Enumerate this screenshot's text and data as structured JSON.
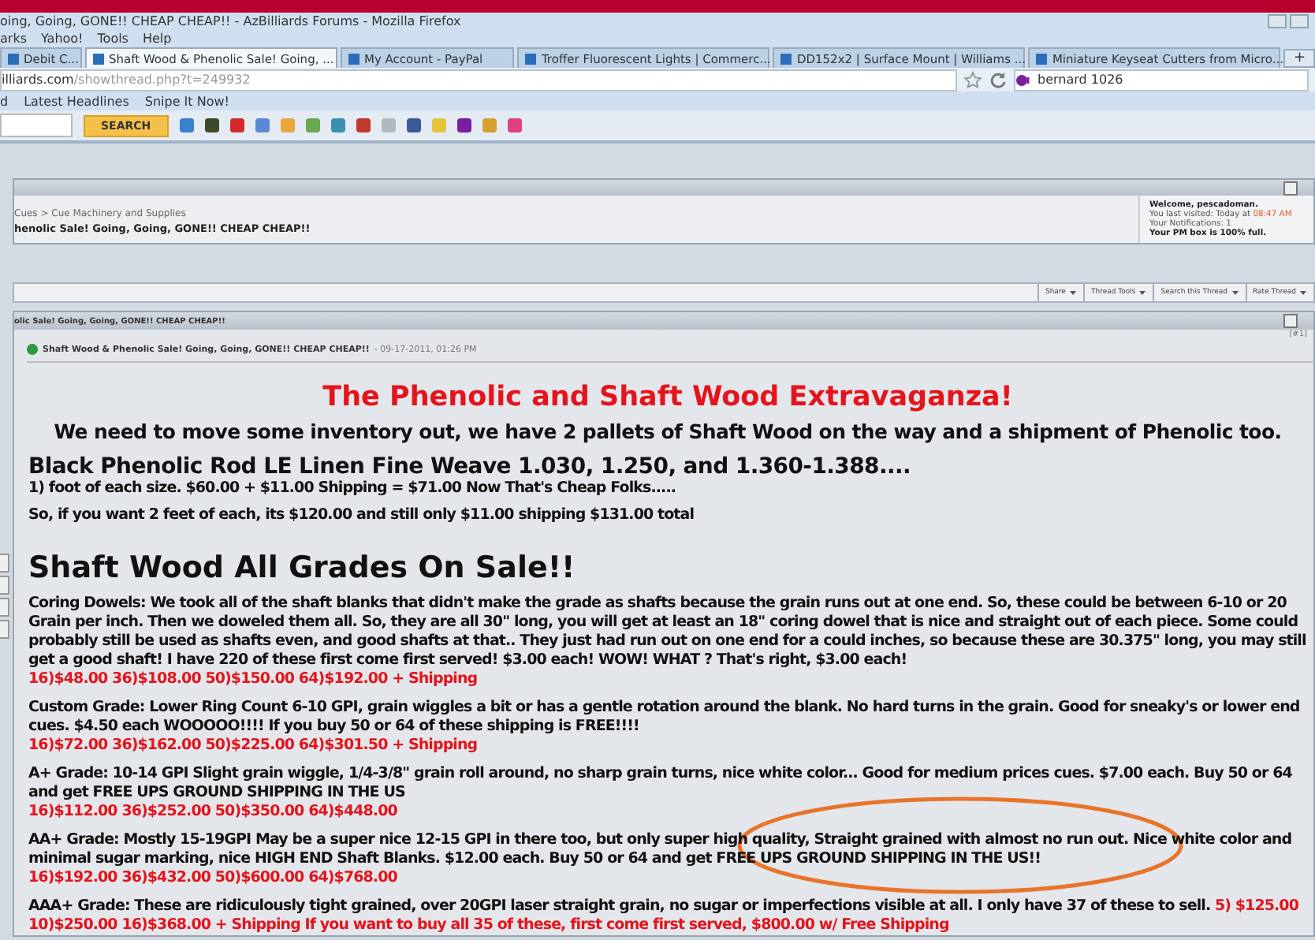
{
  "window": {
    "title": "oing, Going, GONE!! CHEAP CHEAP!! - AzBilliards Forums - Mozilla Firefox"
  },
  "menu": [
    "arks",
    "Yahoo!",
    "Tools",
    "Help"
  ],
  "tabs": [
    {
      "label": "Debit C...",
      "selected": false
    },
    {
      "label": "Shaft Wood & Phenolic Sale! Going, ...",
      "selected": true
    },
    {
      "label": "My Account - PayPal",
      "selected": false
    },
    {
      "label": "Troffer Fluorescent Lights | Commerc...",
      "selected": false
    },
    {
      "label": "DD152x2 | Surface Mount | Williams ...",
      "selected": false
    },
    {
      "label": "Miniature Keyseat Cutters from Micro...",
      "selected": false
    }
  ],
  "address_bar": {
    "url_host": "illiards.com",
    "url_path": "/showthread.php?t=249932",
    "search_value": "bernard 1026"
  },
  "new_tab": "+",
  "bookmarks": [
    "d",
    "Latest Headlines",
    "Snipe It Now!"
  ],
  "toolbar": {
    "search_button": "SEARCH"
  },
  "breadcrumb": {
    "path": "Cues > Cue Machinery and Supplies",
    "title": "henolic Sale! Going, Going, GONE!! CHEAP CHEAP!!"
  },
  "welcome": {
    "greeting": "Welcome, pescadoman.",
    "last_visited": "You last visited: Today at",
    "time": "08:47 AM",
    "notifications": "Your Notifications: 1",
    "pm": "Your PM box is 100% full."
  },
  "thread_tools": [
    "Share",
    "Thread Tools",
    "Search this Thread",
    "Rate Thread"
  ],
  "post": {
    "header": "olic Sale! Going, Going, GONE!! CHEAP CHEAP!!",
    "number": "[#1]",
    "title": "Shaft Wood & Phenolic Sale! Going, Going, GONE!! CHEAP CHEAP!!",
    "date": "- 09-17-2011, 01:26 PM",
    "blocks": [
      {
        "kind": "headline",
        "text": "The Phenolic and Shaft Wood Extravaganza!"
      },
      {
        "kind": "lead",
        "text": "We need to move some inventory out, we have 2 pallets of Shaft Wood on the way and a shipment of Phenolic too."
      },
      {
        "kind": "subheading",
        "text": "Black Phenolic Rod LE Linen Fine Weave 1.030, 1.250, and 1.360-1.388...."
      },
      {
        "kind": "text",
        "text": "1) foot of each size. $60.00 + $11.00 Shipping = $71.00 Now That's Cheap Folks....."
      },
      {
        "kind": "spaced",
        "text": "So, if you want 2 feet of each, its $120.00 and still only $11.00 shipping $131.00 total"
      },
      {
        "kind": "heading",
        "text": "Shaft Wood All Grades On Sale!!"
      },
      {
        "kind": "offer",
        "text": "Coring Dowels: We took all of the shaft blanks that didn't make the grade as shafts because the grain runs out at one end. So, these could be between 6-10 or 20 Grain per inch. Then we doweled them all. So, they are all 30\" long, you will get at least an 18\" coring dowel that is nice and straight out of each piece. Some could probably still be used as shafts even, and good shafts at that.. They just had run out on one end for a could inches, so because these are 30.375\" long, you may still get a good shaft! I have 220 of these first come first served! $3.00 each! WOW! WHAT ? That's right, $3.00 each!",
        "price": "16)$48.00 36)$108.00 50)$150.00 64)$192.00 + Shipping"
      },
      {
        "kind": "offer",
        "text": "Custom Grade: Lower Ring Count 6-10 GPI, grain wiggles a bit or has a gentle rotation around the blank. No hard turns in the grain. Good for sneaky's or lower end cues. $4.50 each WOOOOO!!!! If you buy 50 or 64 of these shipping is FREE!!!!",
        "price": "16)$72.00 36)$162.00 50)$225.00 64)$301.50 + Shipping"
      },
      {
        "kind": "offer",
        "text": "A+ Grade: 10-14 GPI Slight grain wiggle, 1/4-3/8\" grain roll around, no sharp grain turns, nice white color... Good for medium prices cues. $7.00 each. Buy 50 or 64 and get FREE UPS GROUND SHIPPING IN THE US",
        "price": "16)$112.00 36)$252.00 50)$350.00 64)$448.00"
      },
      {
        "kind": "offer",
        "text": "AA+ Grade: Mostly 15-19GPI May be a super nice 12-15 GPI in there too, but only super high quality, Straight grained with almost no run out. Nice white color and minimal sugar marking, nice HIGH END Shaft Blanks. $12.00 each. Buy 50 or 64 and get FREE UPS GROUND SHIPPING IN THE US!!",
        "price": "16)$192.00 36)$432.00 50)$600.00 64)$768.00"
      },
      {
        "kind": "offer_inline",
        "text": "AAA+ Grade: These are ridiculously tight grained, over 20GPI laser straight grain, no sugar or imperfections visible at all. I only have 37 of these to sell.",
        "price": "5) $125.00 10)$250.00 16)$368.00 + Shipping If you want to buy all 35 of these, first come first served, $800.00 w/ Free Shipping"
      }
    ]
  }
}
